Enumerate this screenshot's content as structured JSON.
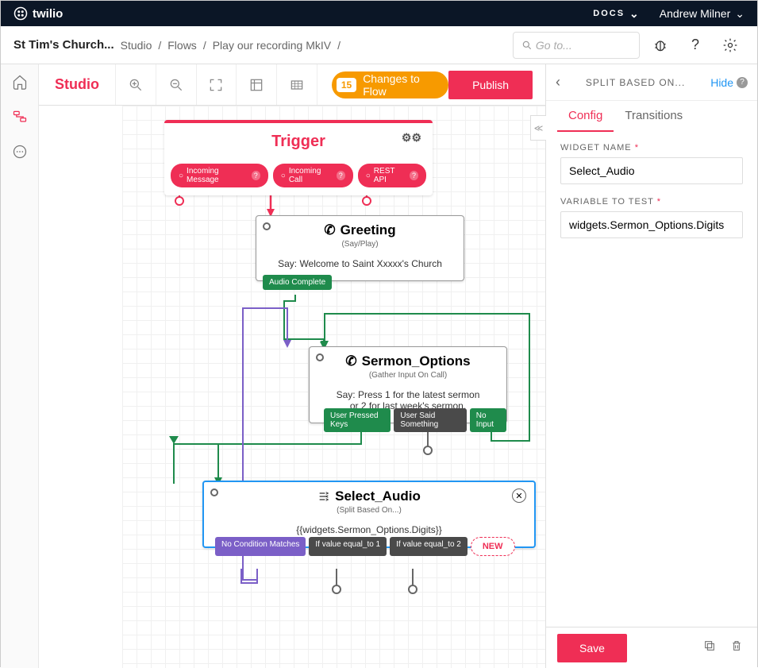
{
  "topbar": {
    "brand": "twilio",
    "docs_label": "DOCS",
    "user_name": "Andrew Milner"
  },
  "breadcrumb": {
    "account": "St Tim's Church...",
    "items": [
      "Studio",
      "Flows",
      "Play our recording MkIV"
    ],
    "search_placeholder": "Go to..."
  },
  "toolbar": {
    "studio_label": "Studio",
    "changes_count": "15",
    "changes_label": "Changes to Flow",
    "publish_label": "Publish"
  },
  "trigger": {
    "title": "Trigger",
    "pills": [
      "Incoming Message",
      "Incoming Call",
      "REST API"
    ]
  },
  "greeting": {
    "title": "Greeting",
    "subtype": "(Say/Play)",
    "body": "Say: Welcome to Saint Xxxxx's Church",
    "out_label": "Audio Complete"
  },
  "sermon": {
    "title": "Sermon_Options",
    "subtype": "(Gather Input On Call)",
    "body_line1": "Say: Press 1 for the latest sermon",
    "body_line2": "or 2 for last week's sermon.",
    "out1": "User Pressed Keys",
    "out2": "User Said Something",
    "out3": "No Input"
  },
  "select_audio": {
    "title": "Select_Audio",
    "subtype": "(Split Based On...)",
    "body": "{{widgets.Sermon_Options.Digits}}",
    "out1": "No Condition Matches",
    "out2": "If value equal_to 1",
    "out3": "If value equal_to 2",
    "new_label": "NEW"
  },
  "panel": {
    "title": "SPLIT BASED ON...",
    "hide_label": "Hide",
    "tab_config": "Config",
    "tab_transitions": "Transitions",
    "widget_name_label": "WIDGET NAME",
    "widget_name_value": "Select_Audio",
    "var_label": "VARIABLE TO TEST",
    "var_value": "widgets.Sermon_Options.Digits",
    "save_label": "Save"
  }
}
